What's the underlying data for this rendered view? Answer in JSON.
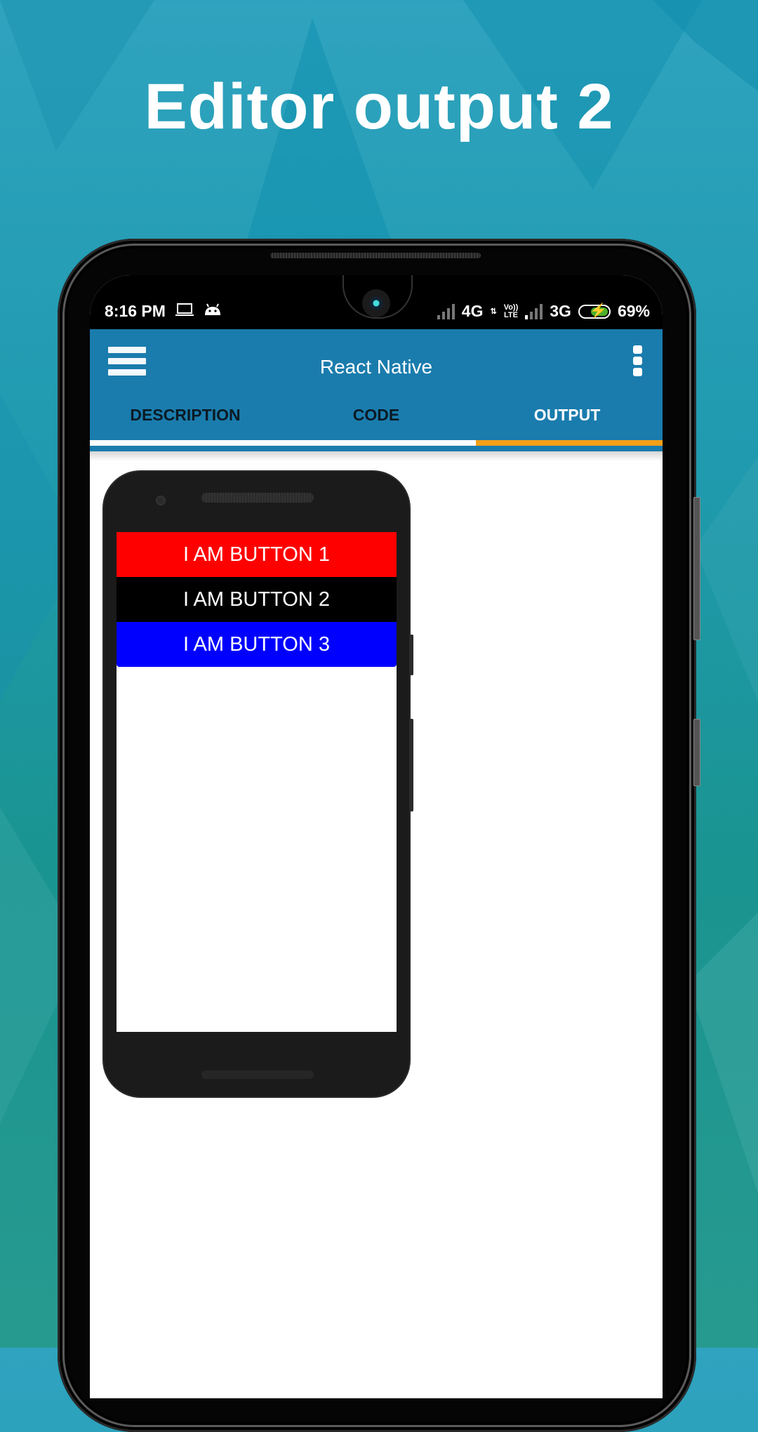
{
  "headline": "Editor output 2",
  "colors": {
    "appbar": "#1a7cad",
    "tab_indicator_active": "#f7a01a",
    "tab_indicator_inactive": "#ffffff",
    "battery_fill": "#4caf2a"
  },
  "status_bar": {
    "time": "8:16 PM",
    "left_icons": [
      "laptop-icon",
      "android-icon"
    ],
    "network_1": "4G",
    "volte_top": "Vo))",
    "volte_bottom": "LTE",
    "network_2": "3G",
    "battery_percent": "69%",
    "battery_level": 0.69,
    "charging": true
  },
  "app_bar": {
    "title": "React Native",
    "menu_icon": "hamburger-menu-icon",
    "overflow_icon": "more-vertical-icon"
  },
  "tabs": [
    {
      "label": "DESCRIPTION",
      "active": false
    },
    {
      "label": "CODE",
      "active": false
    },
    {
      "label": "OUTPUT",
      "active": true
    }
  ],
  "output_preview": {
    "buttons": [
      {
        "label": "I AM BUTTON 1",
        "color": "#ff0000"
      },
      {
        "label": "I AM BUTTON 2",
        "color": "#000000"
      },
      {
        "label": "I AM BUTTON 3",
        "color": "#0000ff"
      }
    ]
  }
}
